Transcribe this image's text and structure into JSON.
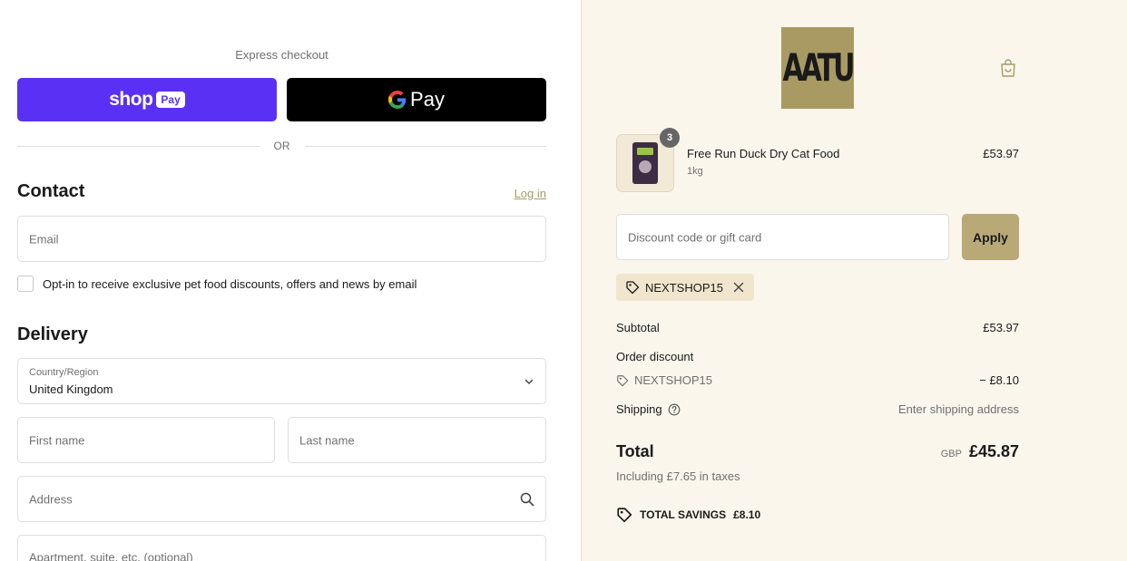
{
  "express": {
    "label": "Express checkout",
    "shop_word": "shop",
    "shop_pay_badge": "Pay",
    "gpay_word": "Pay",
    "or_text": "OR"
  },
  "contact": {
    "heading": "Contact",
    "login_link": "Log in",
    "email_placeholder": "Email",
    "optin_label": "Opt-in to receive exclusive pet food discounts, offers and news by email",
    "optin_checked": false
  },
  "delivery": {
    "heading": "Delivery",
    "country_label": "Country/Region",
    "country_value": "United Kingdom",
    "first_name_placeholder": "First name",
    "last_name_placeholder": "Last name",
    "address_placeholder": "Address",
    "apartment_placeholder": "Apartment, suite, etc. (optional)"
  },
  "brand": {
    "logo_text": "AATU"
  },
  "cart": {
    "item": {
      "quantity": "3",
      "name": "Free Run Duck Dry Cat Food",
      "variant": "1kg",
      "price": "£53.97"
    },
    "discount_placeholder": "Discount code or gift card",
    "apply_label": "Apply",
    "applied_code": "NEXTSHOP15"
  },
  "summary": {
    "subtotal_label": "Subtotal",
    "subtotal_value": "£53.97",
    "order_discount_label": "Order discount",
    "discount_code": "NEXTSHOP15",
    "discount_value": "− £8.10",
    "shipping_label": "Shipping",
    "shipping_value": "Enter shipping address",
    "total_label": "Total",
    "total_currency": "GBP",
    "total_value": "£45.87",
    "taxes_note": "Including £7.65 in taxes",
    "savings_label": "TOTAL SAVINGS",
    "savings_value": "£8.10"
  },
  "colors": {
    "shop_pay": "#5a31f4",
    "accent_gold": "#b9a977",
    "summary_bg": "#faf6ec"
  }
}
